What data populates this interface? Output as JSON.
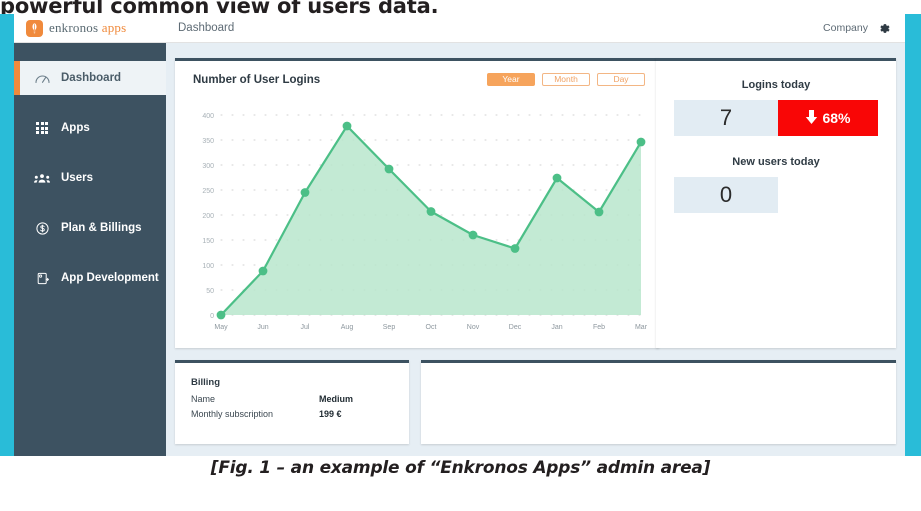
{
  "page": {
    "top_headline": "powerful common view of users data.",
    "caption": "[Fig. 1 – an example of “Enkronos Apps” admin area]"
  },
  "colors": {
    "sidebar": "#3d5261",
    "accent_orange": "#f08a3c",
    "edge_cyan": "#29bcd8",
    "card_border": "#3d5261",
    "chart_green": "#4cbf87",
    "chart_fill": "#b8e6cd",
    "danger_red": "#f90606",
    "stat_box": "#e2ecf3",
    "page_bg": "#e6eef4"
  },
  "brand": {
    "name": "enkronos",
    "suffix": "apps",
    "logo_icon": "enkronos-tree-logo"
  },
  "sidebar": {
    "items": [
      {
        "label": "Dashboard",
        "icon": "gauge-icon",
        "active": true
      },
      {
        "label": "Apps",
        "icon": "grid-icon",
        "active": false
      },
      {
        "label": "Users",
        "icon": "users-icon",
        "active": false
      },
      {
        "label": "Plan & Billings",
        "icon": "dollar-circle-icon",
        "active": false
      },
      {
        "label": "App Development",
        "icon": "app-development-icon",
        "active": false
      }
    ]
  },
  "topbar": {
    "breadcrumb": "Dashboard",
    "company_label": "Company",
    "settings_icon": "gear-icon"
  },
  "chart_card": {
    "title": "Number of User Logins",
    "range_buttons": [
      {
        "label": "Year",
        "selected": true
      },
      {
        "label": "Month",
        "selected": false
      },
      {
        "label": "Day",
        "selected": false
      }
    ]
  },
  "chart_data": {
    "type": "area",
    "title": "Number of User Logins",
    "xlabel": "",
    "ylabel": "",
    "categories": [
      "May",
      "Jun",
      "Jul",
      "Aug",
      "Sep",
      "Oct",
      "Nov",
      "Dec",
      "Jan",
      "Feb",
      "Mar"
    ],
    "values": [
      0,
      88,
      245,
      378,
      292,
      207,
      160,
      133,
      274,
      206,
      346
    ],
    "ylim": [
      0,
      400
    ],
    "yticks": [
      0,
      50,
      100,
      150,
      200,
      250,
      300,
      350,
      400
    ],
    "grid": true,
    "legend": "none",
    "series_color": "#4cbf87",
    "fill_color": "#b8e6cd"
  },
  "stats": [
    {
      "label": "Logins today",
      "value": "7",
      "badge": {
        "text": "68%",
        "icon": "arrow-down-icon",
        "type": "negative"
      }
    },
    {
      "label": "New users today",
      "value": "0",
      "badge": {
        "text": "",
        "icon": "",
        "type": "none"
      }
    }
  ],
  "billing": {
    "title": "Billing",
    "rows": [
      {
        "label": "Name",
        "value": "Medium"
      },
      {
        "label": "Monthly subscription",
        "value": "199 €"
      }
    ]
  },
  "empty_panel": {
    "content": ""
  }
}
